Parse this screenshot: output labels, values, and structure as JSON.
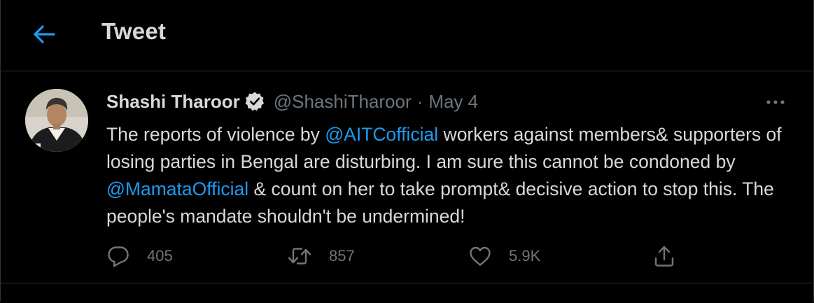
{
  "header": {
    "title": "Tweet",
    "back_icon": "arrow-left-icon"
  },
  "tweet": {
    "author": {
      "display_name": "Shashi Tharoor",
      "handle": "@ShashiTharoor",
      "verified": true
    },
    "separator": "·",
    "date": "May 4",
    "text": {
      "p1": "The reports of violence by ",
      "mention1": "@AITCofficial",
      "p2": " workers against members& supporters of losing parties in Bengal are disturbing. I am sure this cannot be condoned by ",
      "mention2": "@MamataOfficial",
      "p3": " & count on her to take prompt& decisive action to stop this. The people's mandate shouldn't be undermined!"
    },
    "stats": {
      "replies": "405",
      "retweets": "857",
      "likes": "5.9K"
    }
  },
  "colors": {
    "background": "#000000",
    "accent": "#1d9bf0",
    "text_primary": "#d9d9d9",
    "text_secondary": "#6e767d",
    "divider": "#2f3336"
  }
}
